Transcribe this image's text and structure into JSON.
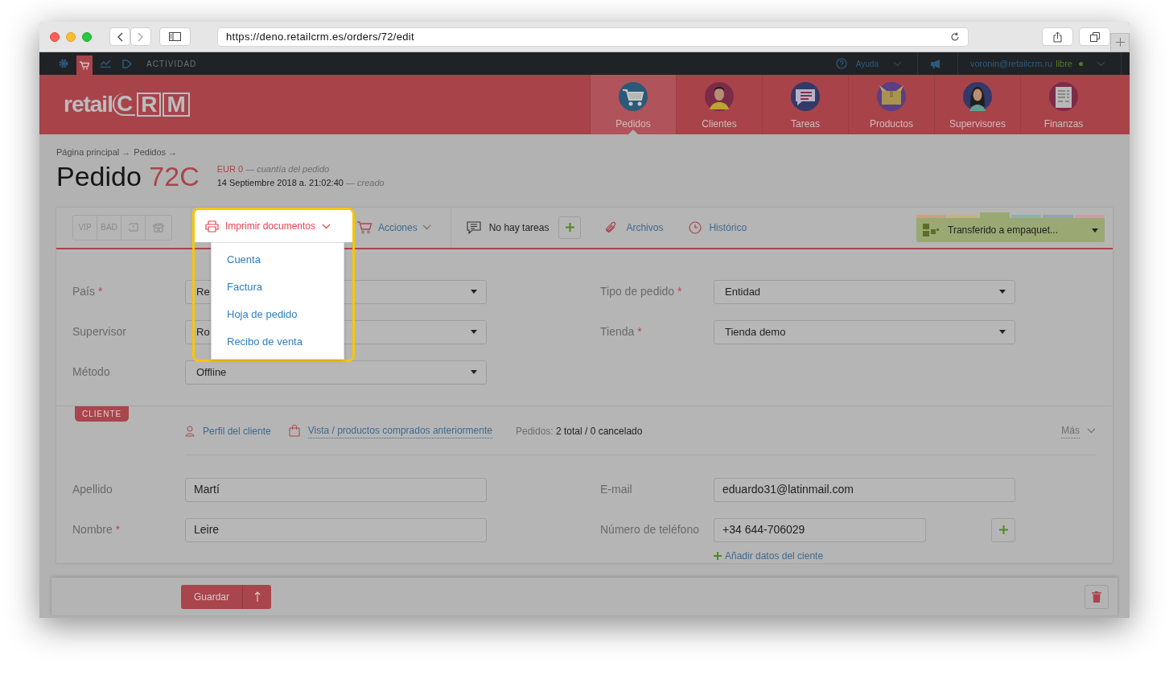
{
  "browser": {
    "url": "https://deno.retailcrm.es/orders/72/edit"
  },
  "topbar": {
    "activity": "ACTIVIDAD",
    "help": "Ayuda",
    "user": "voronin@retailcrm.ru",
    "plan": "libre"
  },
  "logo": {
    "word": "retail",
    "mark": [
      "C",
      "R",
      "M"
    ]
  },
  "nav": [
    {
      "label": "Pedidos",
      "kind": "cart",
      "selected": true
    },
    {
      "label": "Clientes",
      "kind": "person",
      "selected": false
    },
    {
      "label": "Tareas",
      "kind": "chat",
      "selected": false
    },
    {
      "label": "Productos",
      "kind": "box",
      "selected": false
    },
    {
      "label": "Supervisores",
      "kind": "woman",
      "selected": false
    },
    {
      "label": "Finanzas",
      "kind": "ledger",
      "selected": false
    }
  ],
  "breadcrumb": [
    "Página principal →",
    "Pedidos →"
  ],
  "order": {
    "title": "Pedido",
    "number": "72C",
    "amount": "EUR 0",
    "amount_note": "— cuantía del pedido",
    "created": "14 Septiembre 2018 a. 21:02:40",
    "created_note": "— creado"
  },
  "flags": [
    "VIP",
    "BAD"
  ],
  "toolbar": {
    "print": "Imprimir documentos",
    "actions": "Acciones",
    "tasks": "No hay tareas",
    "files": "Archivos",
    "history": "Histórico",
    "status": "Transferido a empaquet..."
  },
  "status_groups": [
    {
      "color": "#c9a27e",
      "selected": false
    },
    {
      "color": "#c2b57a",
      "selected": false
    },
    {
      "color": "#9aa874",
      "selected": true
    },
    {
      "color": "#8fb0ac",
      "selected": false
    },
    {
      "color": "#93a3b3",
      "selected": false
    },
    {
      "color": "#c9a0a4",
      "selected": false
    }
  ],
  "print_menu": [
    "Cuenta",
    "Factura",
    "Hoja de pedido",
    "Recibo de venta"
  ],
  "required_mark": "*",
  "order_fields": [
    [
      {
        "label": "País",
        "required": true,
        "value": "Re"
      },
      {
        "label": "Tipo de pedido",
        "required": true,
        "value": "Entidad"
      }
    ],
    [
      {
        "label": "Supervisor",
        "required": false,
        "value": "Ro"
      },
      {
        "label": "Tienda",
        "required": true,
        "value": "Tienda demo"
      }
    ],
    [
      {
        "label": "Método",
        "required": false,
        "value": "Offline"
      }
    ]
  ],
  "client": {
    "badge": "CLIENTE",
    "profile_link": "Perfil del cliente",
    "history_link": "Vista / productos comprados anteriormente",
    "orders_label": "Pedidos:",
    "orders_value": "2 total / 0 cancelado",
    "more": "Más"
  },
  "client_fields": [
    [
      {
        "label": "Apellido",
        "required": false,
        "value": "Martí"
      },
      {
        "label": "E-mail",
        "required": false,
        "value": "eduardo31@latinmail.com"
      }
    ],
    [
      {
        "label": "Nombre",
        "required": true,
        "value": "Leire"
      },
      {
        "label": "Número de teléfono",
        "required": false,
        "value": "+34 644-706029",
        "add": true
      }
    ]
  ],
  "add_data_link": "Añadir datos del ciente",
  "footer": {
    "save": "Guardar"
  }
}
